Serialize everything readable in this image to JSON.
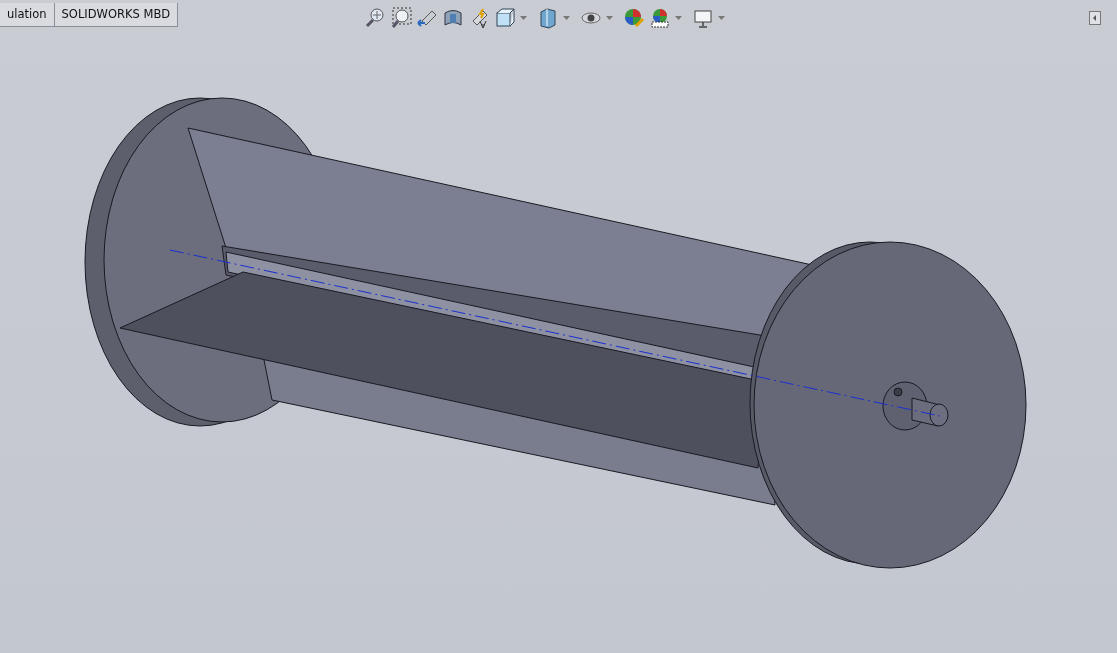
{
  "tabs": [
    {
      "label": "ulation"
    },
    {
      "label": "SOLIDWORKS MBD"
    }
  ],
  "view_toolbar": [
    {
      "kind": "zoom-fit",
      "dropdown": false
    },
    {
      "kind": "zoom-area",
      "dropdown": false
    },
    {
      "kind": "previous-view",
      "dropdown": false
    },
    {
      "kind": "section-view",
      "dropdown": false
    },
    {
      "kind": "annotation",
      "dropdown": false
    },
    {
      "kind": "orientation",
      "dropdown": true
    },
    {
      "kind": "display-style",
      "dropdown": true
    },
    {
      "kind": "hide-show",
      "dropdown": true
    },
    {
      "kind": "appearance",
      "dropdown": false
    },
    {
      "kind": "scene",
      "dropdown": true
    },
    {
      "kind": "display",
      "dropdown": true
    }
  ]
}
